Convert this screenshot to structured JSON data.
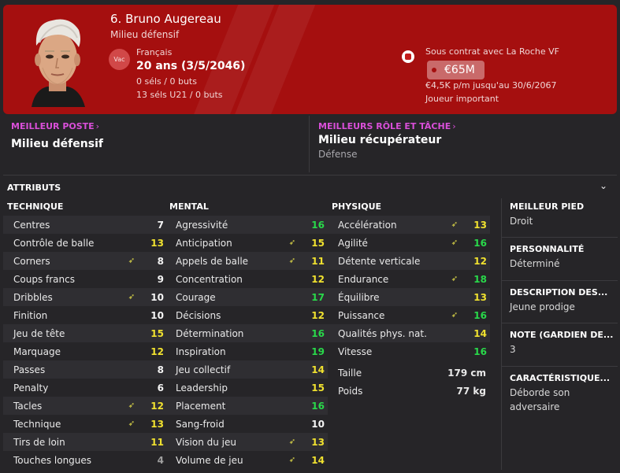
{
  "player": {
    "name": "6. Bruno Augereau",
    "role": "Milieu défensif",
    "nationality_badge": "Vac",
    "nationality": "Français",
    "age": "20 ans (3/5/2046)",
    "caps": "0 séls / 0 buts",
    "caps_u21": "13 séls U21 / 0 buts",
    "contract_club": "Sous contrat avec La Roche VF",
    "value": "€65M",
    "wage": "€4,5K p/m jusqu'au 30/6/2067",
    "squad_status": "Joueur important"
  },
  "colors": {
    "header_red": "#a50f0f",
    "link_pink": "#d94fd9",
    "attr_green": "#29d84a",
    "attr_yellow": "#f0e12f"
  },
  "best_position": {
    "label": "MEILLEUR POSTE",
    "value": "Milieu défensif"
  },
  "best_role": {
    "label": "MEILLEURS RÔLE ET TÂCHE",
    "value": "Milieu récupérateur",
    "duty": "Défense"
  },
  "attributes": {
    "title": "ATTRIBUTS",
    "technical": {
      "title": "TECHNIQUE",
      "rows": [
        {
          "name": "Centres",
          "value": "7",
          "key": false,
          "tone": "white"
        },
        {
          "name": "Contrôle de balle",
          "value": "13",
          "key": false,
          "tone": "yellow"
        },
        {
          "name": "Corners",
          "value": "8",
          "key": true,
          "tone": "white"
        },
        {
          "name": "Coups francs",
          "value": "9",
          "key": false,
          "tone": "white"
        },
        {
          "name": "Dribbles",
          "value": "10",
          "key": true,
          "tone": "white"
        },
        {
          "name": "Finition",
          "value": "10",
          "key": false,
          "tone": "white"
        },
        {
          "name": "Jeu de tête",
          "value": "15",
          "key": false,
          "tone": "yellow"
        },
        {
          "name": "Marquage",
          "value": "12",
          "key": false,
          "tone": "yellow"
        },
        {
          "name": "Passes",
          "value": "8",
          "key": false,
          "tone": "white"
        },
        {
          "name": "Penalty",
          "value": "6",
          "key": false,
          "tone": "white"
        },
        {
          "name": "Tacles",
          "value": "12",
          "key": true,
          "tone": "yellow"
        },
        {
          "name": "Technique",
          "value": "13",
          "key": true,
          "tone": "yellow"
        },
        {
          "name": "Tirs de loin",
          "value": "11",
          "key": false,
          "tone": "yellow"
        },
        {
          "name": "Touches longues",
          "value": "4",
          "key": false,
          "tone": "gray"
        }
      ]
    },
    "mental": {
      "title": "MENTAL",
      "rows": [
        {
          "name": "Agressivité",
          "value": "16",
          "key": false,
          "tone": "green"
        },
        {
          "name": "Anticipation",
          "value": "15",
          "key": true,
          "tone": "yellow"
        },
        {
          "name": "Appels de balle",
          "value": "11",
          "key": true,
          "tone": "yellow"
        },
        {
          "name": "Concentration",
          "value": "12",
          "key": false,
          "tone": "yellow"
        },
        {
          "name": "Courage",
          "value": "17",
          "key": false,
          "tone": "green"
        },
        {
          "name": "Décisions",
          "value": "12",
          "key": false,
          "tone": "yellow"
        },
        {
          "name": "Détermination",
          "value": "16",
          "key": false,
          "tone": "green"
        },
        {
          "name": "Inspiration",
          "value": "19",
          "key": false,
          "tone": "green"
        },
        {
          "name": "Jeu collectif",
          "value": "14",
          "key": false,
          "tone": "yellow"
        },
        {
          "name": "Leadership",
          "value": "15",
          "key": false,
          "tone": "yellow"
        },
        {
          "name": "Placement",
          "value": "16",
          "key": false,
          "tone": "green"
        },
        {
          "name": "Sang-froid",
          "value": "10",
          "key": false,
          "tone": "white"
        },
        {
          "name": "Vision du jeu",
          "value": "13",
          "key": true,
          "tone": "yellow"
        },
        {
          "name": "Volume de jeu",
          "value": "14",
          "key": true,
          "tone": "yellow"
        }
      ]
    },
    "physical": {
      "title": "PHYSIQUE",
      "rows": [
        {
          "name": "Accélération",
          "value": "13",
          "key": true,
          "tone": "yellow"
        },
        {
          "name": "Agilité",
          "value": "16",
          "key": true,
          "tone": "green"
        },
        {
          "name": "Détente verticale",
          "value": "12",
          "key": false,
          "tone": "yellow"
        },
        {
          "name": "Endurance",
          "value": "18",
          "key": true,
          "tone": "green"
        },
        {
          "name": "Équilibre",
          "value": "13",
          "key": false,
          "tone": "yellow"
        },
        {
          "name": "Puissance",
          "value": "16",
          "key": true,
          "tone": "green"
        },
        {
          "name": "Qualités phys. nat.",
          "value": "14",
          "key": false,
          "tone": "yellow"
        },
        {
          "name": "Vitesse",
          "value": "16",
          "key": false,
          "tone": "green"
        }
      ],
      "extra": [
        {
          "name": "Taille",
          "value": "179 cm"
        },
        {
          "name": "Poids",
          "value": "77 kg"
        }
      ]
    }
  },
  "side": {
    "preferred_foot": {
      "label": "MEILLEUR PIED",
      "value": "Droit"
    },
    "personality": {
      "label": "PERSONNALITÉ",
      "value": "Déterminé"
    },
    "description": {
      "label": "DESCRIPTION DES...",
      "value": "Jeune prodige"
    },
    "gk_rating": {
      "label": "NOTE (GARDIEN DE...",
      "value": "3"
    },
    "characteristic": {
      "label": "CARACTÉRISTIQUE...",
      "value": "Déborde son adversaire"
    }
  },
  "icons": {
    "key_attribute": "key-attribute-arrow-icon",
    "collapse": "chevron-down-icon",
    "link": "chevron-right-icon",
    "club": "club-crest-icon"
  }
}
